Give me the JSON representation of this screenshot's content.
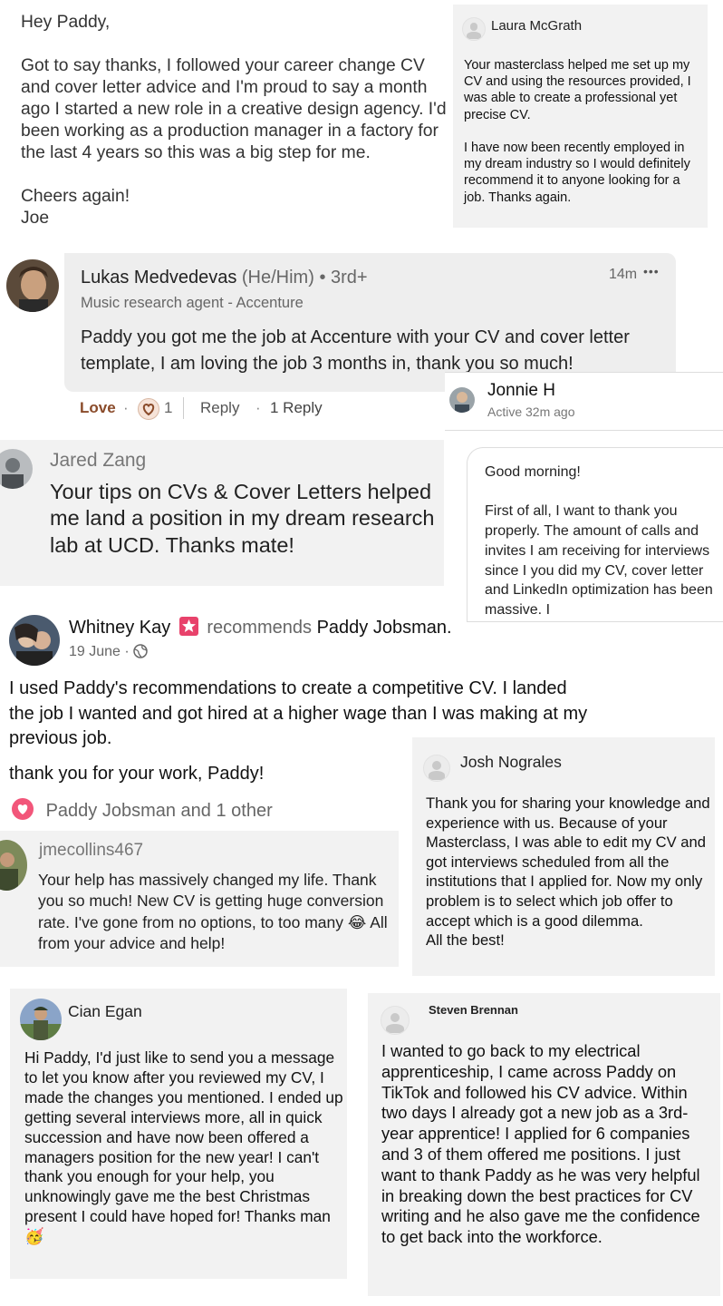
{
  "joe": {
    "text": "Hey Paddy,\n\nGot to say thanks, I followed your career change CV and cover letter advice and I'm proud to say a month ago I started a new role in a creative design agency. I'd been working as a production manager in a factory for the last 4 years so this was a big step for me.\n\nCheers again!\nJoe"
  },
  "laura": {
    "name": "Laura McGrath",
    "text": "Your masterclass helped me set up my CV and using the resources provided, I was able to create a professional yet precise CV.\n\nI have now been recently employed in my dream industry so I would definitely recommend it to anyone looking for a job. Thanks again."
  },
  "lukas": {
    "name": "Lukas Medvedevas",
    "pronouns": "(He/Him)",
    "degree": "• 3rd+",
    "headline": "Music research agent - Accenture",
    "time": "14m",
    "more": "•••",
    "text": "Paddy you got me the job at Accenture with your CV and cover letter template, I am loving the job 3 months in, thank you so much!",
    "love_label": "Love",
    "sep1": "·",
    "reaction_count": "1",
    "reply_label": "Reply",
    "sep2": "·",
    "replies_label": "1 Reply"
  },
  "jonnie": {
    "name": "Jonnie H",
    "status": "Active 32m ago",
    "text": "Good morning!\n\nFirst of all, I want to thank you properly. The amount of calls and invites I am receiving for interviews since I you did my CV, cover letter and LinkedIn optimization has been massive. I"
  },
  "jared": {
    "name": "Jared Zang",
    "text": "Your tips on CVs & Cover Letters helped me land a position in my dream research lab at UCD. Thanks mate!"
  },
  "whitney": {
    "name": "Whitney Kay",
    "recommends": "recommends",
    "target": "Paddy Jobsman",
    "period": ".",
    "date": "19 June ·",
    "text1": "I used Paddy's recommendations to create a competitive CV. I landed the job I wanted and got hired at a higher wage than I was making at my previous job.",
    "text2": "thank you for your work, Paddy!",
    "reactions": "Paddy Jobsman and 1 other"
  },
  "josh": {
    "name": "Josh Nograles",
    "text": "Thank you for sharing your knowledge and experience with us. Because of your Masterclass, I was able to edit my CV and got interviews scheduled from all the institutions that I applied for. Now my only problem is to select which job offer to accept which is a good dilemma.\nAll the best!"
  },
  "jme": {
    "name": "jmecollins467",
    "text_before": "Your help has massively changed my life. Thank you so much! New CV is getting huge conversion rate. I've gone from no options, to too many",
    "emoji": "😂",
    "text_after": "All from your advice and help!"
  },
  "cian": {
    "name": "Cian Egan",
    "text": "Hi Paddy, I'd just like to send you a message to let you know after you reviewed my CV, I made the changes you mentioned. I ended up getting several interviews more, all in quick succession and have now been offered a managers position for the new year! I can't thank you enough for your help, you unknowingly gave me the best Christmas present I could have hoped for! Thanks man",
    "emoji": "🥳"
  },
  "steven": {
    "name": "Steven Brennan",
    "text": "I wanted to go back to my electrical apprenticeship, I came across Paddy on TikTok and followed his CV advice. Within two days I already got a new job as a 3rd-year apprentice! I applied for 6 companies and 3 of them offered me positions. I just want to thank Paddy as he was very helpful in breaking down the best practices for CV writing and he also gave me the confidence to get back into the workforce."
  },
  "colors": {
    "card_gray": "#f2f2f2",
    "linkedin_bubble": "#eeeeee",
    "love_brown": "#8a4b2a",
    "heart_pink": "#e0245e",
    "badge_pink": "#e8426b"
  }
}
